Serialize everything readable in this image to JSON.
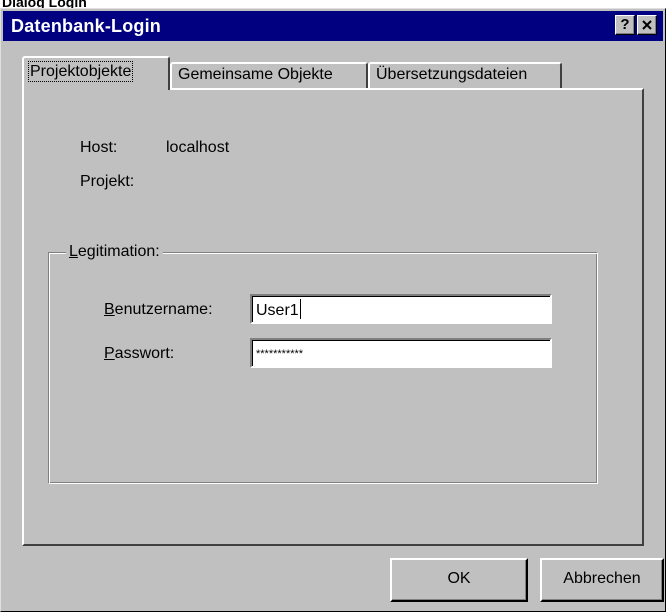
{
  "document": {
    "caption": "Dialog Login"
  },
  "window": {
    "title": "Datenbank-Login",
    "help_glyph": "?",
    "close_glyph": "×"
  },
  "tabs": [
    {
      "label": "Projektobjekte",
      "active": true
    },
    {
      "label": "Gemeinsame Objekte",
      "active": false
    },
    {
      "label": "Übersetzungsdateien",
      "active": false
    }
  ],
  "info": {
    "host_label": "Host:",
    "host_value": "localhost",
    "project_label": "Projekt:",
    "project_value": ""
  },
  "credentials": {
    "group_label_accel": "L",
    "group_label_rest": "egitimation:",
    "username_label_accel": "B",
    "username_label_rest": "enutzername:",
    "username_value": "User1",
    "password_label_accel": "P",
    "password_label_rest": "asswort:",
    "password_value": "***********"
  },
  "buttons": {
    "ok": "OK",
    "cancel": "Abbrechen"
  },
  "colors": {
    "titlebar": "#000080",
    "face": "#c0c0c0"
  }
}
